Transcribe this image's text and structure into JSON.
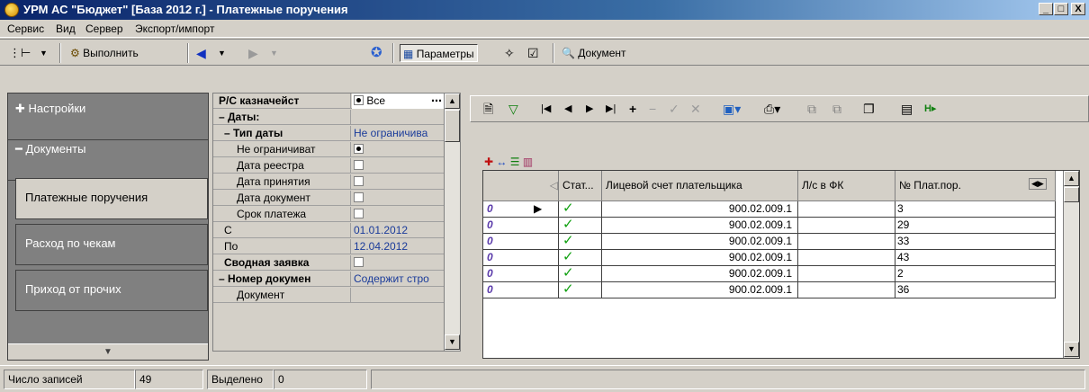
{
  "window": {
    "title": "УРМ АС \"Бюджет\" [База 2012 г.] - Платежные поручения",
    "buttons": [
      "_",
      "□",
      "X"
    ]
  },
  "menu": [
    "Сервис",
    "Вид",
    "Сервер",
    "Экспорт/импорт"
  ],
  "toolbar": {
    "execute_label": "Выполнить",
    "params_label": "Параметры",
    "document_label": "Документ"
  },
  "nav": {
    "settings_label": "Настройки",
    "documents_label": "Документы",
    "items": [
      "Платежные поручения",
      "Расход по чекам",
      "Приход от прочих"
    ]
  },
  "params": [
    {
      "name": "Р/С казначейст",
      "value": "Все",
      "bold": true
    },
    {
      "name": "– Даты:",
      "value": "",
      "bold": true
    },
    {
      "name": "– Тип даты",
      "value": "Не ограничива",
      "bold": true
    },
    {
      "name": "Не ограничиват",
      "value": "",
      "checked": true
    },
    {
      "name": "Дата реестра",
      "value": "",
      "checked": false
    },
    {
      "name": "Дата принятия",
      "value": "",
      "checked": false
    },
    {
      "name": "Дата документ",
      "value": "",
      "checked": false
    },
    {
      "name": "Срок платежа",
      "value": "",
      "checked": false
    },
    {
      "name": "С",
      "value": "01.01.2012"
    },
    {
      "name": "По",
      "value": "12.04.2012"
    },
    {
      "name": "Сводная заявка",
      "value": "",
      "bold": true,
      "checked": false
    },
    {
      "name": "– Номер докумен",
      "value": "Содержит стро",
      "bold": true
    },
    {
      "name": "Документ",
      "value": ""
    }
  ],
  "grid": {
    "columns": [
      "Стат...",
      "Лицевой счет плательщика",
      "Л/с в ФК",
      "№ Плат.пор."
    ],
    "rows": [
      {
        "account": "900.02.009.1",
        "fk": "",
        "num": "3"
      },
      {
        "account": "900.02.009.1",
        "fk": "",
        "num": "29"
      },
      {
        "account": "900.02.009.1",
        "fk": "",
        "num": "33"
      },
      {
        "account": "900.02.009.1",
        "fk": "",
        "num": "43"
      },
      {
        "account": "900.02.009.1",
        "fk": "",
        "num": "2"
      },
      {
        "account": "900.02.009.1",
        "fk": "",
        "num": "36"
      }
    ]
  },
  "status": {
    "records_label": "Число записей",
    "records_value": "49",
    "selected_label": "Выделено",
    "selected_value": "0"
  }
}
